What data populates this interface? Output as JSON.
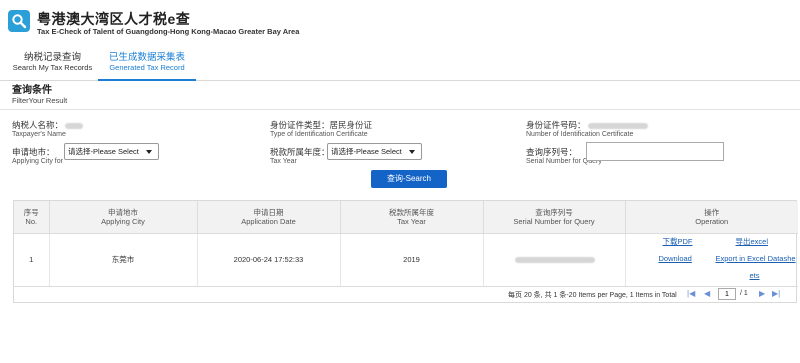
{
  "header": {
    "title": "粤港澳大湾区人才税e查",
    "subtitle": "Tax E-Check of Talent of Guangdong-Hong Kong-Macao Greater Bay Area",
    "logo_icon": "magnifier-icon",
    "accent": "#2a9fd8"
  },
  "tabs": [
    {
      "zh": "纳税记录查询",
      "en": "Search My Tax Records",
      "active": false
    },
    {
      "zh": "已生成数据采集表",
      "en": "Generated Tax Record",
      "active": true
    }
  ],
  "filter": {
    "title_zh": "查询条件",
    "title_en": "FilterYour Result",
    "taxpayer_name": {
      "zh": "纳税人名称：",
      "en": "Taxpayer's Name"
    },
    "id_type": {
      "zh": "身份证件类型：",
      "value": "居民身份证",
      "en": "Type of Identification Certificate"
    },
    "id_number": {
      "zh": "身份证件号码：",
      "en": "Number of Identification Certificate"
    },
    "applying_city": {
      "zh": "申请地市：",
      "en": "Applying City for",
      "selected": "请选择-Please Select"
    },
    "tax_year": {
      "zh": "税款所属年度：",
      "en": "Tax Year",
      "selected": "请选择-Please Select"
    },
    "serial_number": {
      "zh": "查询序列号：",
      "en": "Serial Number for Query",
      "value": ""
    },
    "search_button": "查询-Search",
    "button_color": "#1464c8"
  },
  "table": {
    "headers": [
      {
        "zh": "序号",
        "en": "No."
      },
      {
        "zh": "申请地市",
        "en": "Applying City"
      },
      {
        "zh": "申请日期",
        "en": "Application Date"
      },
      {
        "zh": "税款所属年度",
        "en": "Tax Year"
      },
      {
        "zh": "查询序列号",
        "en": "Serial Number for Query"
      },
      {
        "zh": "操作",
        "en": "Operation"
      }
    ],
    "rows": [
      {
        "no": "1",
        "city": "东莞市",
        "date": "2020-06-24 17:52:33",
        "year": "2019",
        "ops": {
          "download_pdf_zh": "下载PDF",
          "export_excel_zh": "导出excel",
          "download_en": "Download",
          "export_en_line1": "Export in Excel Datashe",
          "export_en_line2": "ets"
        }
      }
    ]
  },
  "pagination": {
    "summary": "每页 20 条, 共 1 条-20 Items per Page, 1 Items in Total",
    "current_page": "1",
    "total": "/ 1",
    "first": "|◀",
    "prev": "◀",
    "next": "▶",
    "last": "▶|"
  }
}
